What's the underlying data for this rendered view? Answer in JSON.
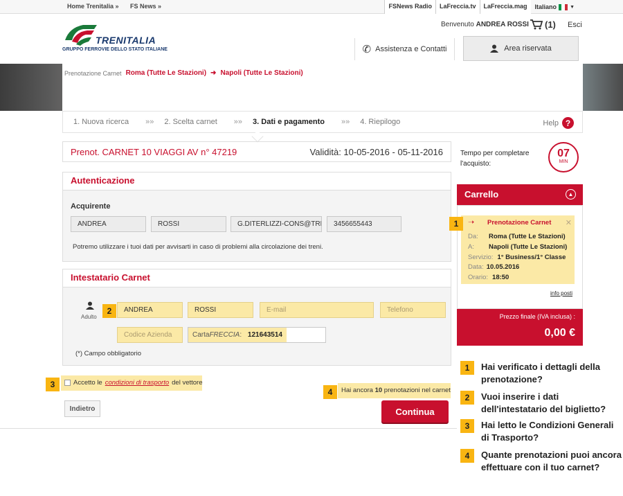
{
  "topnav": {
    "links": [
      "Home Trenitalia »",
      "FS News »"
    ],
    "external": [
      "FSNews Radio",
      "LaFreccia.tv",
      "LaFreccia.mag"
    ],
    "language": "Italiano"
  },
  "header": {
    "logo_text": "TRENITALIA",
    "logo_subtitle": "GRUPPO FERROVIE DELLO STATO ITALIANE",
    "welcome": "Benvenuto",
    "user_name": "ANDREA ROSSI",
    "cart_count": "(1)",
    "logout": "Esci",
    "assistance": "Assistenza e Contatti",
    "reserved_area": "Area riservata"
  },
  "breadcrumb": {
    "label": "Prenotazione Carnet",
    "from": "Roma (Tutte Le Stazioni)",
    "to": "Napoli (Tutte Le Stazioni)"
  },
  "steps": {
    "items": [
      "1. Nuova ricerca",
      "2. Scelta carnet",
      "3. Dati e pagamento",
      "4. Riepilogo"
    ],
    "separator": "»»",
    "active_index": 2,
    "help": "Help"
  },
  "prenotazione": {
    "title": "Prenot. CARNET 10 VIAGGI AV n° 47219",
    "validity": "Validità: 10-05-2016 - 05-11-2016"
  },
  "auth": {
    "title": "Autenticazione",
    "buyer_label": "Acquirente",
    "first_name": "ANDREA",
    "last_name": "ROSSI",
    "email": "G.DITERLIZZI-CONS@TREN",
    "phone": "3456655443",
    "note": "Potremo utilizzare i tuoi dati per avvisarti in caso di problemi alla circolazione dei treni."
  },
  "holder": {
    "title": "Intestatario Carnet",
    "adult_label": "Adulto",
    "first_name": "ANDREA",
    "last_name": "ROSSI",
    "email_placeholder": "E-mail",
    "phone_placeholder": "Telefono",
    "company_placeholder": "Codice Azienda",
    "card_label_prefix": "Carta",
    "card_label_brand": "FRECCIA",
    "card_label_suffix": ":",
    "card_number": "121643514",
    "required_note": "(*) Campo obbligatorio"
  },
  "conditions": {
    "prefix": "Accetto le ",
    "link": "condizioni di trasporto",
    "suffix": " del vettore"
  },
  "remaining": {
    "prefix": "Hai ancora ",
    "count": "10",
    "suffix": " prenotazioni nel carnet"
  },
  "buttons": {
    "back": "Indietro",
    "continue": "Continua"
  },
  "timer": {
    "text_line1": "Tempo per completare",
    "text_line2": "l'acquisto:",
    "value": "07",
    "unit": "MIN"
  },
  "cart": {
    "title": "Carrello",
    "item_title": "Prenotazione Carnet",
    "rows": [
      {
        "k": "Da:",
        "v": "Roma (Tutte Le Stazioni)"
      },
      {
        "k": "A:",
        "v": "Napoli (Tutte Le Stazioni)"
      },
      {
        "k": "Servizio:",
        "v": "1° Business/1° Classe"
      },
      {
        "k": "Data:",
        "v": "10.05.2016"
      },
      {
        "k": "Orario:",
        "v": "18:50"
      }
    ],
    "info_link": "info posti",
    "price_label": "Prezzo finale (IVA inclusa) :",
    "price_value": "0,00 €"
  },
  "badges": [
    "1",
    "2",
    "3",
    "4"
  ],
  "questions": [
    {
      "n": "1",
      "text": "Hai verificato i dettagli della prenotazione?"
    },
    {
      "n": "2",
      "text": "Vuoi inserire i dati dell'intestatario del biglietto?"
    },
    {
      "n": "3",
      "text": "Hai letto le Condizioni Generali di Trasporto?"
    },
    {
      "n": "4",
      "text": "Quante prenotazioni puoi ancora effettuare con il tuo carnet?"
    }
  ],
  "colors": {
    "accent": "#c8102e",
    "highlight": "#fbe9a6",
    "badge": "#f9b512"
  }
}
